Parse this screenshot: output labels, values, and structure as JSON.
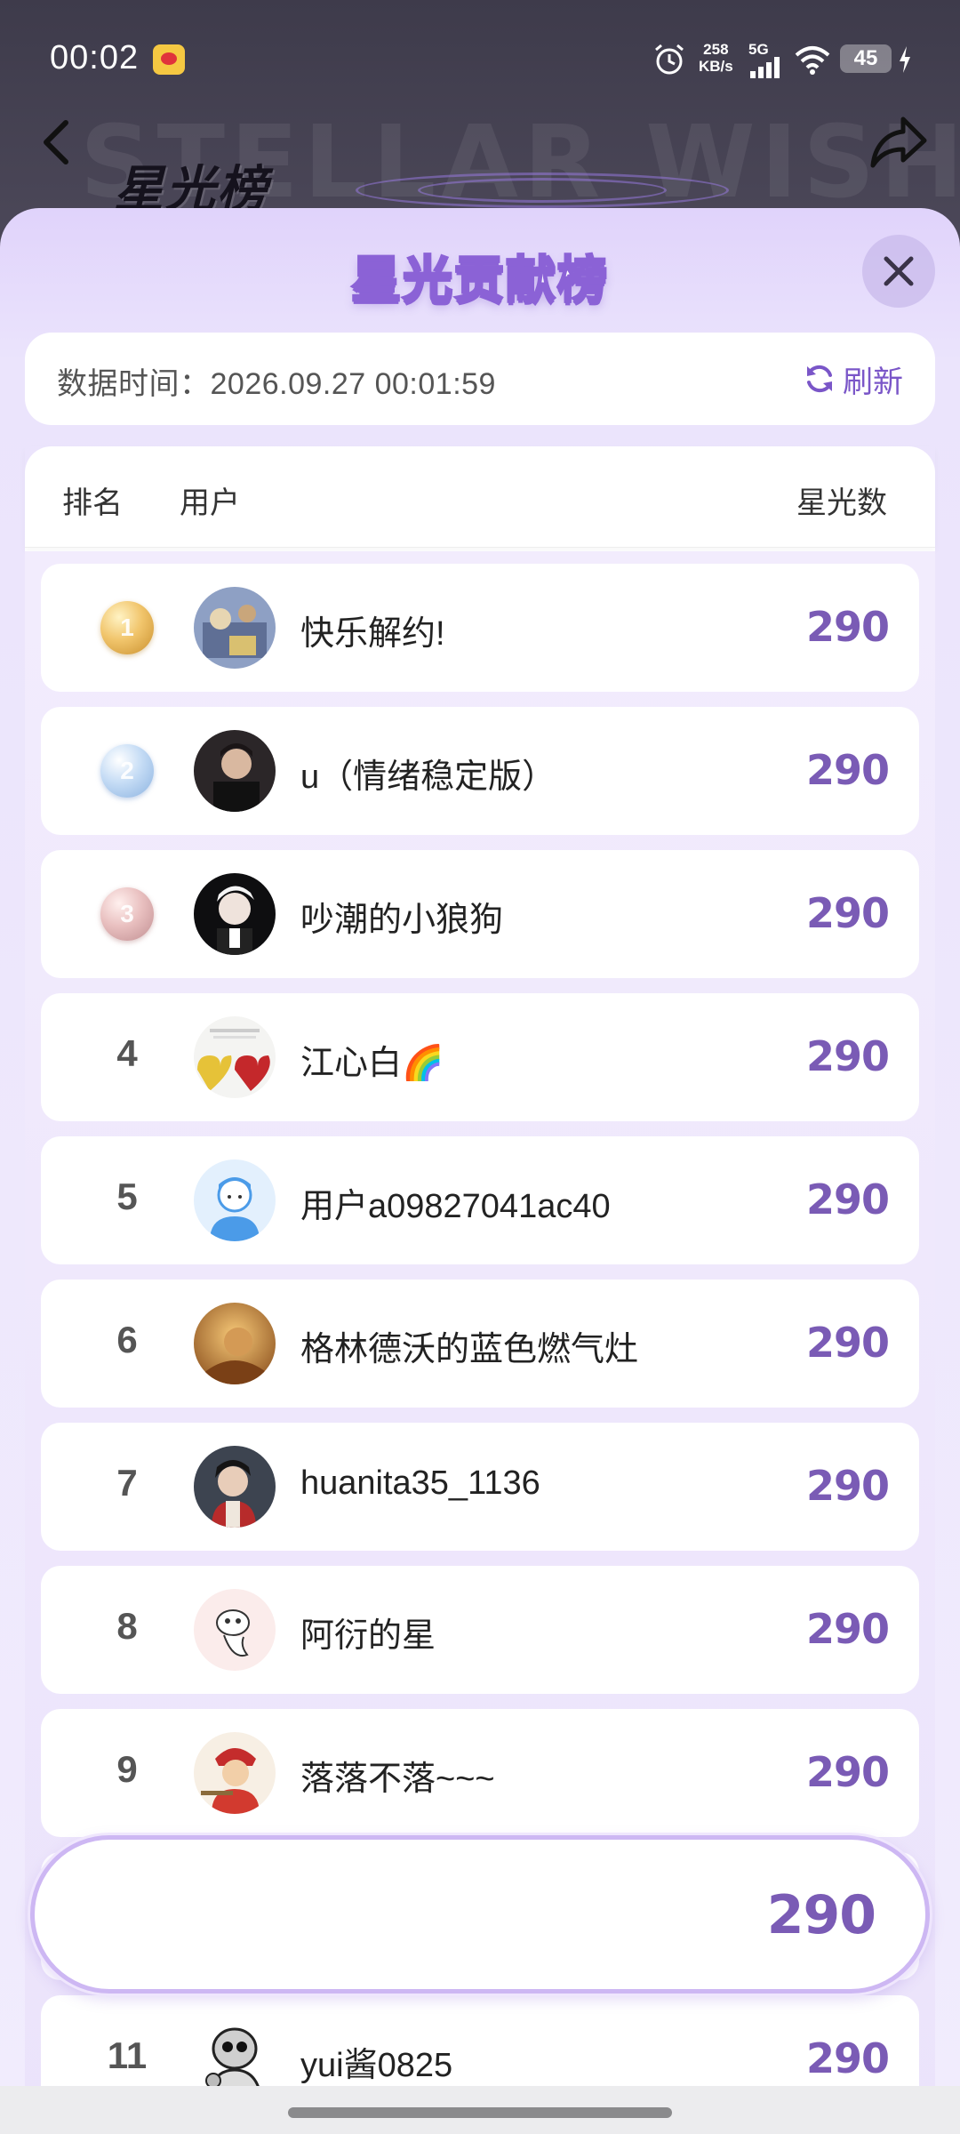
{
  "status_bar": {
    "time": "00:02",
    "net_speed_value": "258",
    "net_speed_unit": "KB/s",
    "network_type": "5G",
    "battery_level": "45"
  },
  "background": {
    "watermark": "STELLAR WISH",
    "title": "星光榜"
  },
  "sheet": {
    "title": "星光贡献榜",
    "data_time_label": "数据时间：",
    "data_time_value": "2026.09.27 00:01:59",
    "refresh_label": "刷新"
  },
  "list_header": {
    "rank": "排名",
    "user": "用户",
    "stars": "星光数"
  },
  "rows": [
    {
      "rank": "1",
      "name": "快乐解约!",
      "score": "290",
      "medal": "gold"
    },
    {
      "rank": "2",
      "name": "u（情绪稳定版）",
      "score": "290",
      "medal": "silver"
    },
    {
      "rank": "3",
      "name": "吵潮的小狼狗",
      "score": "290",
      "medal": "bronze"
    },
    {
      "rank": "4",
      "name": "江心白🌈",
      "score": "290"
    },
    {
      "rank": "5",
      "name": "用户a09827041ac40",
      "score": "290"
    },
    {
      "rank": "6",
      "name": "格林德沃的蓝色燃气灶",
      "score": "290"
    },
    {
      "rank": "7",
      "name": "huanita35_1136",
      "score": "290"
    },
    {
      "rank": "8",
      "name": "阿衍的星",
      "score": "290"
    },
    {
      "rank": "9",
      "name": "落落不落~~~",
      "score": "290"
    },
    {
      "rank": "11",
      "name": "yui酱0825",
      "score": "290"
    }
  ],
  "my_rank_bar": {
    "score": "290"
  },
  "colors": {
    "accent": "#7a5bb5",
    "sheet_bg": "#ebe4fc",
    "title_stroke": "#8b62d6"
  },
  "icons": [
    "back-icon",
    "share-icon",
    "close-icon",
    "refresh-icon",
    "alarm-icon",
    "wifi-icon",
    "signal-icon",
    "charge-icon"
  ]
}
